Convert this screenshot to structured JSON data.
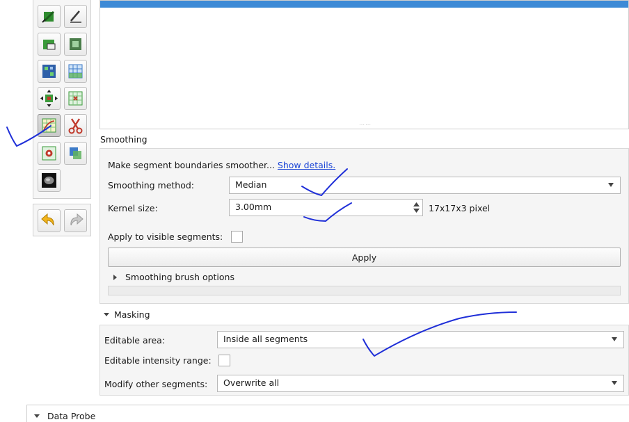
{
  "smoothing": {
    "section_title": "Smoothing",
    "description": "Make segment boundaries smoother...",
    "details_link": "Show details.",
    "method_label": "Smoothing method:",
    "method_value": "Median",
    "kernel_label": "Kernel size:",
    "kernel_value": "3.00mm",
    "kernel_pixels": "17x17x3 pixel",
    "visible_label": "Apply to visible segments:",
    "apply_button": "Apply",
    "brush_options": "Smoothing brush options"
  },
  "masking": {
    "section_title": "Masking",
    "editable_area_label": "Editable area:",
    "editable_area_value": "Inside all segments",
    "intensity_label": "Editable intensity range:",
    "modify_label": "Modify other segments:",
    "modify_value": "Overwrite all"
  },
  "data_probe": {
    "title": "Data Probe"
  },
  "effects": [
    "paint-icon",
    "draw-icon",
    "erase-icon",
    "level-tracing-icon",
    "grow-from-seeds-icon",
    "fill-between-slices-icon",
    "threshold-icon",
    "margin-icon",
    "smoothing-icon",
    "scissors-icon",
    "islands-icon",
    "logical-operators-icon",
    "mask-volume-icon"
  ],
  "colors": {
    "selection_bar": "#3d8ad6",
    "link": "#1a44d6",
    "annotation_pen": "#1f2fd8"
  }
}
